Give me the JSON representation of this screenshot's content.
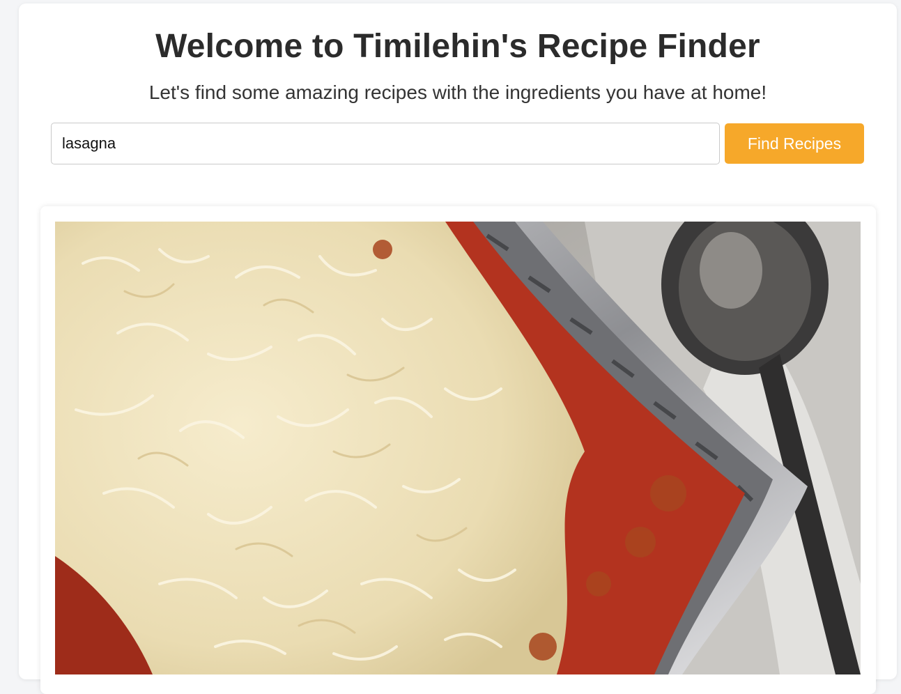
{
  "header": {
    "title": "Welcome to Timilehin's Recipe Finder",
    "subtitle": "Let's find some amazing recipes with the ingredients you have at home!"
  },
  "search": {
    "value": "lasagna",
    "placeholder": "",
    "button_label": "Find Recipes"
  },
  "results": [
    {
      "image_alt": "lasagna-photo",
      "image_icon": "lasagna-photo"
    }
  ],
  "colors": {
    "accent": "#f6a82a",
    "background": "#f4f5f7",
    "card": "#ffffff",
    "title": "#2b2b2b"
  }
}
